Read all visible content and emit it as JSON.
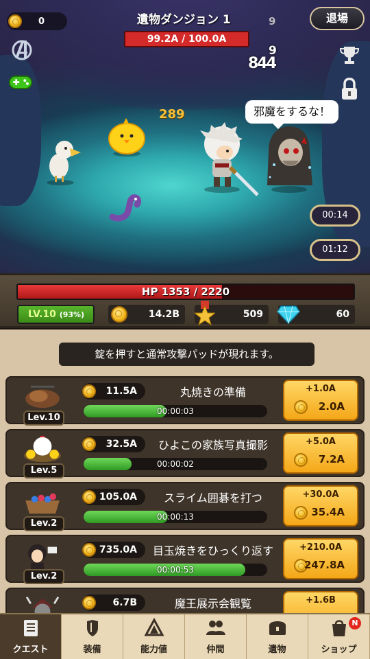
{
  "hud": {
    "gold": "0",
    "dungeon_title": "遺物ダンジョン 1",
    "boss_hp": "99.2A / 100.0A",
    "floating_number": "9",
    "leave_label": "退場",
    "damage_top": "9",
    "damage_main": "844",
    "damage_yellow": "289",
    "speech": "邪魔をするな！",
    "timer1": "00:14",
    "timer2": "01:12",
    "icons": [
      "avengers-logo-icon",
      "gamepad-icon",
      "trophy-icon",
      "padlock-icon"
    ]
  },
  "stats": {
    "hp_text": "HP 1353 / 2220",
    "hp_fraction": 0.609,
    "level": "LV.10",
    "level_pct": "(93%)",
    "gold": "14.2B",
    "medals": "509",
    "gems": "60"
  },
  "tip": "錠を押すと通常攻撃パッドが現れます。",
  "quests": [
    {
      "name": "丸焼きの準備",
      "cost": "11.5A",
      "level": "Lev.10",
      "time": "00:00:03",
      "progress": 0.45,
      "increase": "+1.0A",
      "price": "2.0A"
    },
    {
      "name": "ひよこの家族写真撮影",
      "cost": "32.5A",
      "level": "Lev.5",
      "time": "00:00:02",
      "progress": 0.26,
      "increase": "+5.0A",
      "price": "7.2A"
    },
    {
      "name": "スライム囲碁を打つ",
      "cost": "105.0A",
      "level": "Lev.2",
      "time": "00:00:13",
      "progress": 0.46,
      "increase": "+30.0A",
      "price": "35.4A"
    },
    {
      "name": "目玉焼きをひっくり返す",
      "cost": "735.0A",
      "level": "Lev.2",
      "time": "00:00:53",
      "progress": 0.88,
      "increase": "+210.0A",
      "price": "247.8A"
    },
    {
      "name": "魔王展示会観覧",
      "cost": "6.7B",
      "level": "",
      "time": "",
      "progress": 0,
      "increase": "+1.6B",
      "price": ""
    }
  ],
  "nav": [
    {
      "label": "クエスト",
      "icon": "quest-scroll-icon",
      "active": true
    },
    {
      "label": "装備",
      "icon": "equipment-icon",
      "active": false
    },
    {
      "label": "能力値",
      "icon": "ability-triangle-icon",
      "active": false
    },
    {
      "label": "仲間",
      "icon": "party-people-icon",
      "active": false
    },
    {
      "label": "遺物",
      "icon": "relic-chest-icon",
      "active": false
    },
    {
      "label": "ショップ",
      "icon": "shop-bag-icon",
      "active": false,
      "badge": "N"
    }
  ],
  "colors": {
    "hp_red": "#d42a2a",
    "progress_green": "#4cc23a",
    "button_gold": "#f6b62a",
    "panel_brown": "#3e3429"
  }
}
